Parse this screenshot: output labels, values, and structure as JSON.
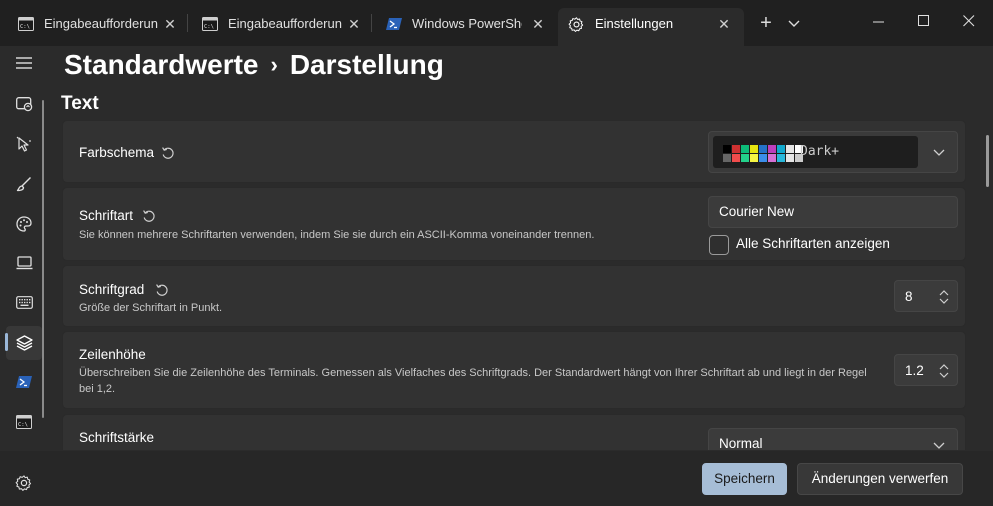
{
  "tabs": [
    {
      "label": "Eingabeaufforderun",
      "icon": "cmd-icon",
      "active": false
    },
    {
      "label": "Eingabeaufforderun",
      "icon": "cmd-icon",
      "active": false
    },
    {
      "label": "Windows PowerShel",
      "icon": "powershell-icon",
      "active": false
    },
    {
      "label": "Einstellungen",
      "icon": "gear-icon",
      "active": true
    }
  ],
  "tab_close_glyph": "✕",
  "new_tab_glyph": "+",
  "breadcrumb": {
    "parent": "Standardwerte",
    "separator": "›",
    "current": "Darstellung"
  },
  "section_title": "Text",
  "settings": {
    "color_scheme": {
      "title": "Farbschema",
      "selected": "Dark+",
      "swatches": [
        "#000000",
        "#cd3131",
        "#0dbc79",
        "#e5e510",
        "#2472c8",
        "#bc3fbc",
        "#11a8cd",
        "#e5e5e5",
        "#ffffff",
        "#666666",
        "#f14c4c",
        "#23d18b",
        "#f5f543",
        "#3b8eea",
        "#d670d6",
        "#29b8db",
        "#e5e5e5",
        "#cccccc"
      ]
    },
    "font_face": {
      "title": "Schriftart",
      "description": "Sie können mehrere Schriftarten verwenden, indem Sie sie durch ein ASCII-Komma voneinander trennen.",
      "value": "Courier New",
      "checkbox_label": "Alle Schriftarten anzeigen",
      "checkbox_checked": false
    },
    "font_size": {
      "title": "Schriftgrad",
      "description": "Größe der Schriftart in Punkt.",
      "value": "8"
    },
    "line_height": {
      "title": "Zeilenhöhe",
      "description": "Überschreiben Sie die Zeilenhöhe des Terminals. Gemessen als Vielfaches des Schriftgrads. Der Standardwert hängt von Ihrer Schriftart ab und liegt in der Regel bei 1,2.",
      "value": "1.2"
    },
    "font_weight": {
      "title": "Schriftstärke",
      "value": "Normal"
    }
  },
  "footer": {
    "save_label": "Speichern",
    "discard_label": "Änderungen verwerfen"
  },
  "colors": {
    "accent": "#a6bdd6",
    "background": "#202020",
    "card": "#323232"
  }
}
